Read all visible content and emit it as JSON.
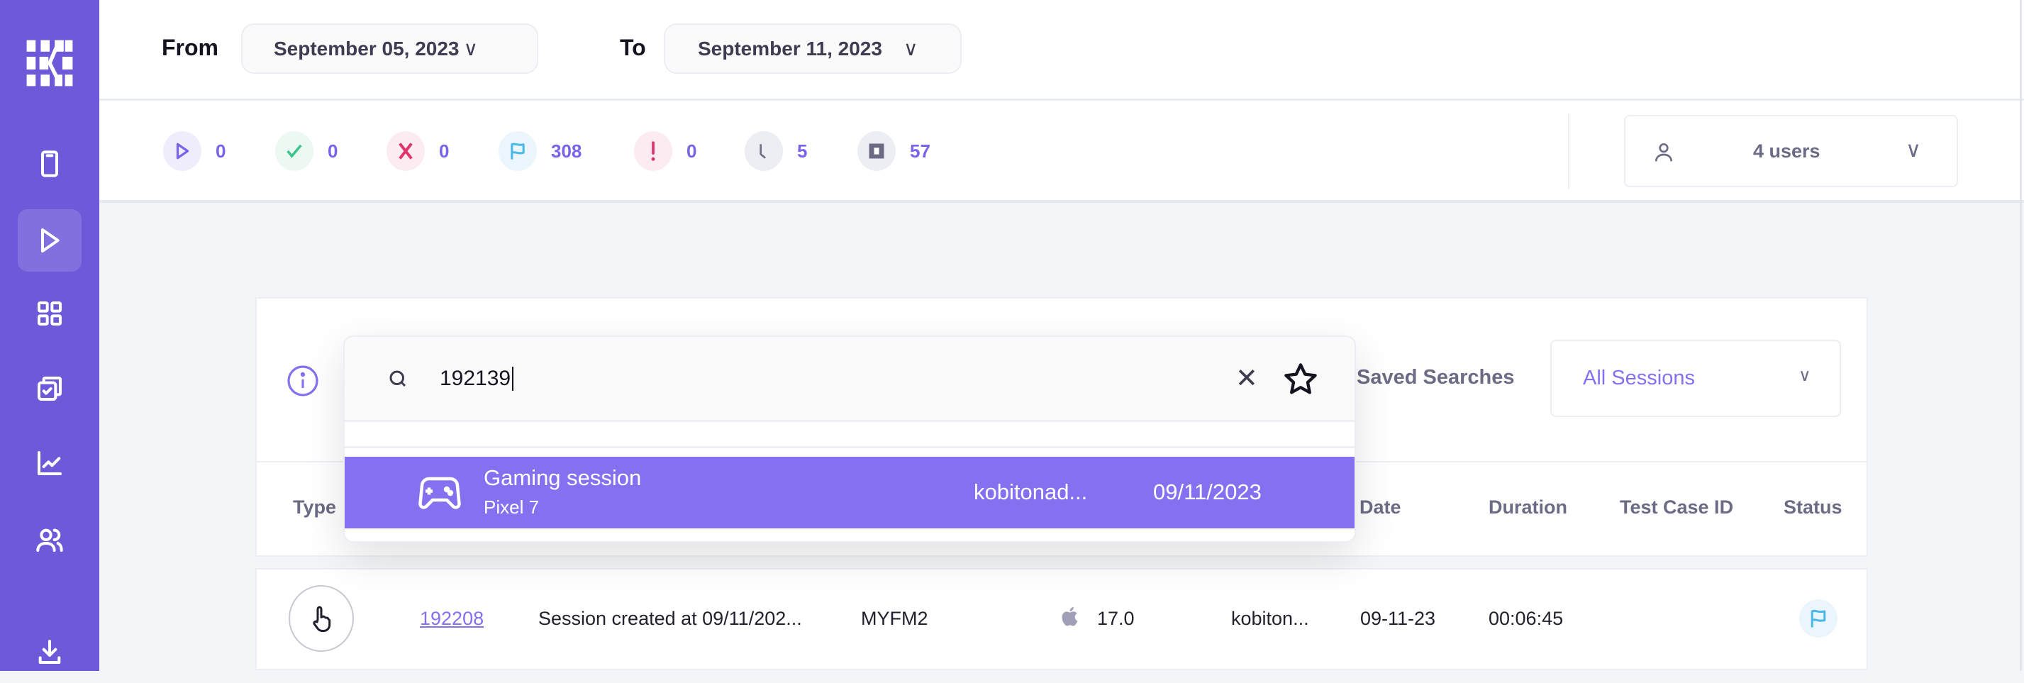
{
  "header": {
    "from_label": "From",
    "from_date": "September 05, 2023",
    "to_label": "To",
    "to_date": "September 11, 2023"
  },
  "stats": [
    {
      "icon": "play-icon",
      "value": "0",
      "color": "#7a63ea",
      "bg": "#efedfc"
    },
    {
      "icon": "check-icon",
      "value": "0",
      "color": "#3cc48a",
      "bg": "#ecf8f2"
    },
    {
      "icon": "x-icon",
      "value": "0",
      "color": "#e0336b",
      "bg": "#fcecf1"
    },
    {
      "icon": "flag-icon",
      "value": "308",
      "color": "#4ab8e8",
      "bg": "#eaf6fc"
    },
    {
      "icon": "exclamation-icon",
      "value": "0",
      "color": "#e0336b",
      "bg": "#fcecf1"
    },
    {
      "icon": "clock-icon",
      "value": "5",
      "color": "#6b6b85",
      "bg": "#eceef3"
    },
    {
      "icon": "stop-icon",
      "value": "57",
      "color": "#6b6b85",
      "bg": "#eceef3"
    }
  ],
  "users": {
    "label": "4 users"
  },
  "search": {
    "value": "192139",
    "saved_searches_label": "Saved Searches",
    "saved_search_selected": "All Sessions"
  },
  "suggestion": {
    "title": "Gaming session",
    "device": "Pixel 7",
    "user": "kobitonad...",
    "date": "09/11/2023"
  },
  "table": {
    "headers": {
      "type": "Type",
      "date": "Date",
      "duration": "Duration",
      "test_case_id": "Test Case ID",
      "status": "Status"
    },
    "rows": [
      {
        "id": "192208",
        "name": "Session created at 09/11/202...",
        "device": "MYFM2",
        "os_version": "17.0",
        "user": "kobiton...",
        "date": "09-11-23",
        "duration": "00:06:45",
        "test_case_id": ""
      }
    ]
  },
  "colors": {
    "brand": "#6e59d9",
    "accent": "#8570f0"
  }
}
